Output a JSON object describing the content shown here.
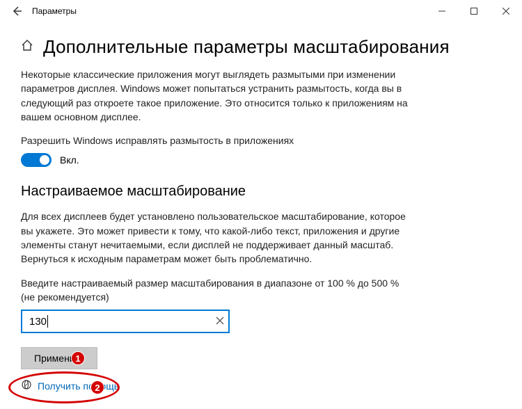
{
  "titlebar": {
    "title": "Параметры"
  },
  "heading": "Дополнительные параметры масштабирования",
  "intro": "Некоторые классические приложения могут выглядеть размытыми при изменении параметров дисплея. Windows может попытаться устранить размытость, когда вы в следующий раз откроете такое приложение. Это относится только к приложениям на вашем основном дисплее.",
  "fixblur_label": "Разрешить Windows исправлять размытость в приложениях",
  "toggle_state": "Вкл.",
  "section2_heading": "Настраиваемое масштабирование",
  "section2_para": "Для всех дисплеев будет установлено пользовательское масштабирование, которое вы укажете. Это может привести к тому, что какой-либо текст, приложения и другие элементы станут нечитаемыми, если дисплей не поддерживает данный масштаб. Вернуться к исходным параметрам может быть проблематично.",
  "input_prompt": "Введите настраиваемый размер масштабирования в диапазоне от 100 % до 500 % (не рекомендуется)",
  "scale_value": "130",
  "apply_label": "Применить",
  "help_label": "Получить помощь",
  "annotations": {
    "one": "1",
    "two": "2"
  }
}
